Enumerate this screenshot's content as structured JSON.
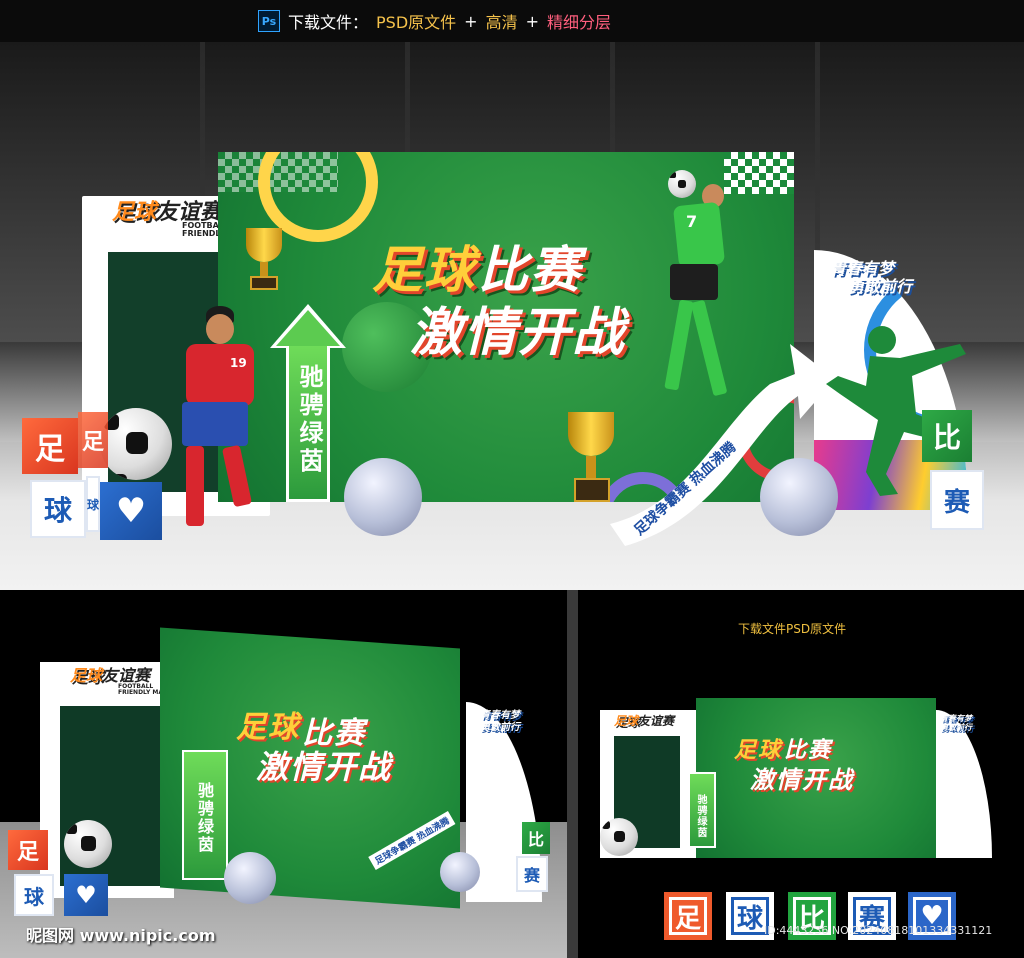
{
  "topbar": {
    "ps_icon": "Ps",
    "label": "下载文件：",
    "format": "PSD原文件",
    "plus1": "+",
    "hd": "高清",
    "plus2": "+",
    "layers": "精细分层"
  },
  "design": {
    "logo_main": "足球",
    "logo_accent": "友谊赛",
    "logo_sub_line1": "FOOTBALL",
    "logo_sub_line2": "FRIENDLY MATCH",
    "headline_line1_a": "足球",
    "headline_line1_b": "比赛",
    "headline_line2": "激情开战",
    "arrow_vertical_text": "驰骋绿茵",
    "ribbon_text": "足球争霸赛 热血沸腾",
    "slogan_line1": "青春有梦",
    "slogan_line2": "勇敢前行",
    "player_red_number": "19",
    "player_green_number": "7",
    "cubes_left": [
      "足",
      "足",
      "球",
      "球"
    ],
    "cubes_right": [
      "比",
      "赛"
    ],
    "heart_icon": "♥",
    "colors": {
      "board_green": "#1f8a3a",
      "accent_orange": "#e2452b",
      "accent_gold": "#ffcf3a",
      "cube_red": "#ef5a2c",
      "cube_blue": "#2b66c8",
      "cube_green": "#22a43f"
    }
  },
  "right_panel": {
    "caption": "下载文件PSD原文件",
    "tiles": [
      "足",
      "球",
      "比",
      "赛",
      "♥"
    ],
    "id_text": "ID:4443236 NO:20240818101334331121"
  },
  "left_panel": {
    "watermark": "昵图网 www.nipic.com"
  }
}
